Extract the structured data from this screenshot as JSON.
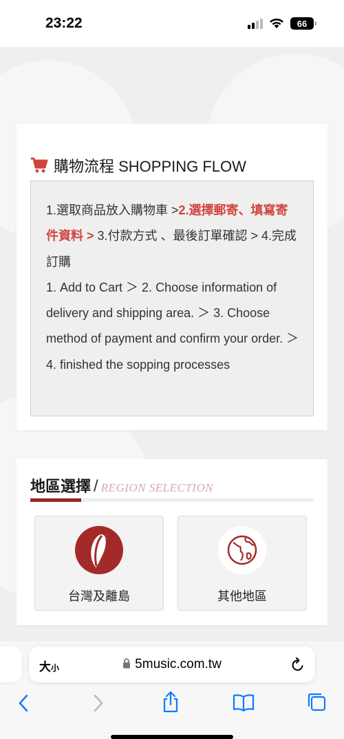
{
  "status_bar": {
    "time": "23:22",
    "battery": "66"
  },
  "shopping_flow": {
    "title": "購物流程 SHOPPING FLOW",
    "step1_zh": "1.選取商品放入購物車 >",
    "step2_zh": "2.選擇郵寄、填寫寄件資料 >",
    "step3_zh": " 3.付款方式 、最後訂單確認 > 4.完成訂購",
    "steps_en": "1. Add to Cart ＞ 2. Choose information of delivery and shipping area. ＞ 3. Choose method of payment and confirm your order. ＞ 4. finished the sopping processes"
  },
  "region": {
    "title_zh": "地區選擇",
    "slash": "/",
    "title_en": "REGION SELECTION",
    "options": [
      {
        "label": "台灣及離島",
        "icon": "taiwan-map-icon"
      },
      {
        "label": "其他地區",
        "icon": "globe-icon"
      }
    ]
  },
  "browser": {
    "text_size_big": "大",
    "text_size_small": "小",
    "url": "5music.com.tw"
  },
  "colors": {
    "accent_red": "#d0453f",
    "brand_dark_red": "#9b2226",
    "region_en_pink": "#d9a9ab",
    "ios_blue": "#0a7aff"
  }
}
